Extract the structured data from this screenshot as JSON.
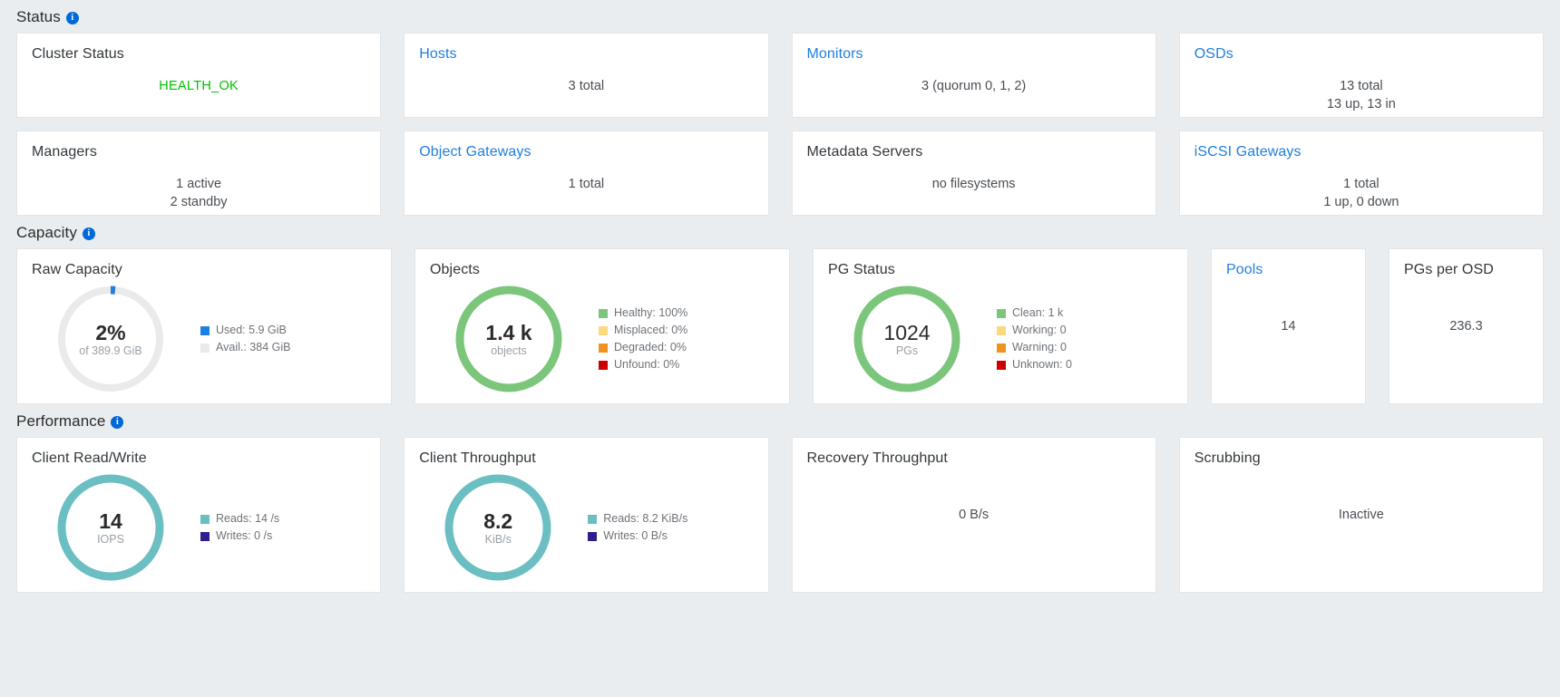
{
  "sections": {
    "status": {
      "title": "Status",
      "info_icon": "info-icon"
    },
    "capacity": {
      "title": "Capacity",
      "info_icon": "info-icon"
    },
    "performance": {
      "title": "Performance",
      "info_icon": "info-icon"
    }
  },
  "status_cards": [
    {
      "title": "Cluster Status",
      "link": false,
      "lines": [
        "HEALTH_OK"
      ],
      "health": true
    },
    {
      "title": "Hosts",
      "link": true,
      "lines": [
        "3 total"
      ],
      "health": false
    },
    {
      "title": "Monitors",
      "link": true,
      "lines": [
        "3 (quorum 0, 1, 2)"
      ],
      "health": false
    },
    {
      "title": "OSDs",
      "link": true,
      "lines": [
        "13 total",
        "13 up, 13 in"
      ],
      "health": false
    },
    {
      "title": "Managers",
      "link": false,
      "lines": [
        "1 active",
        "2 standby"
      ],
      "health": false
    },
    {
      "title": "Object Gateways",
      "link": true,
      "lines": [
        "1 total"
      ],
      "health": false
    },
    {
      "title": "Metadata Servers",
      "link": false,
      "lines": [
        "no filesystems"
      ],
      "health": false
    },
    {
      "title": "iSCSI Gateways",
      "link": true,
      "lines": [
        "1 total",
        "1 up, 0 down"
      ],
      "health": false
    }
  ],
  "capacity_cards": {
    "raw_capacity": {
      "title": "Raw Capacity",
      "center_value": "2%",
      "center_sub": "of 389.9 GiB",
      "legend": [
        {
          "label": "Used: 5.9 GiB",
          "color": "#1f7fe0"
        },
        {
          "label": "Avail.: 384 GiB",
          "color": "#eaeaea"
        }
      ]
    },
    "objects": {
      "title": "Objects",
      "center_value": "1.4 k",
      "center_sub": "objects",
      "legend": [
        {
          "label": "Healthy: 100%",
          "color": "#7bc67b"
        },
        {
          "label": "Misplaced: 0%",
          "color": "#fad97f"
        },
        {
          "label": "Degraded: 0%",
          "color": "#f0921e"
        },
        {
          "label": "Unfound: 0%",
          "color": "#cc0000"
        }
      ]
    },
    "pg_status": {
      "title": "PG Status",
      "center_value": "1024",
      "center_sub": "PGs",
      "legend": [
        {
          "label": "Clean: 1 k",
          "color": "#7bc67b"
        },
        {
          "label": "Working: 0",
          "color": "#fad97f"
        },
        {
          "label": "Warning: 0",
          "color": "#f0921e"
        },
        {
          "label": "Unknown: 0",
          "color": "#cc0000"
        }
      ]
    },
    "pools": {
      "title": "Pools",
      "link": true,
      "value": "14"
    },
    "pgs_per_osd": {
      "title": "PGs per OSD",
      "link": false,
      "value": "236.3"
    }
  },
  "performance_cards": {
    "client_read_write": {
      "title": "Client Read/Write",
      "center_value": "14",
      "center_sub": "IOPS",
      "legend": [
        {
          "label": "Reads: 14 /s",
          "color": "#6bbec2"
        },
        {
          "label": "Writes: 0 /s",
          "color": "#2d1f8f"
        }
      ]
    },
    "client_throughput": {
      "title": "Client Throughput",
      "center_value": "8.2",
      "center_sub": "KiB/s",
      "legend": [
        {
          "label": "Reads: 8.2 KiB/s",
          "color": "#6bbec2"
        },
        {
          "label": "Writes: 0 B/s",
          "color": "#2d1f8f"
        }
      ]
    },
    "recovery_throughput": {
      "title": "Recovery Throughput",
      "value": "0 B/s"
    },
    "scrubbing": {
      "title": "Scrubbing",
      "value": "Inactive"
    }
  },
  "chart_data": [
    {
      "type": "pie",
      "title": "Raw Capacity",
      "labels": [
        "Used: 5.9 GiB",
        "Avail.: 384 GiB"
      ],
      "values": [
        5.9,
        384
      ],
      "percent": [
        1.5,
        98.5
      ],
      "colors": [
        "#1f7fe0",
        "#eaeaea"
      ],
      "center_label": "2%",
      "center_sublabel": "of 389.9 GiB",
      "legend_position": "right",
      "donut": true
    },
    {
      "type": "pie",
      "title": "Objects",
      "labels": [
        "Healthy: 100%",
        "Misplaced: 0%",
        "Degraded: 0%",
        "Unfound: 0%"
      ],
      "values": [
        100,
        0,
        0,
        0
      ],
      "colors": [
        "#7bc67b",
        "#fad97f",
        "#f0921e",
        "#cc0000"
      ],
      "center_label": "1.4 k",
      "center_sublabel": "objects",
      "legend_position": "right",
      "donut": true
    },
    {
      "type": "pie",
      "title": "PG Status",
      "labels": [
        "Clean: 1 k",
        "Working: 0",
        "Warning: 0",
        "Unknown: 0"
      ],
      "values": [
        1024,
        0,
        0,
        0
      ],
      "colors": [
        "#7bc67b",
        "#fad97f",
        "#f0921e",
        "#cc0000"
      ],
      "center_label": "1024",
      "center_sublabel": "PGs",
      "legend_position": "right",
      "donut": true
    },
    {
      "type": "pie",
      "title": "Client Read/Write",
      "labels": [
        "Reads: 14 /s",
        "Writes: 0 /s"
      ],
      "values": [
        14,
        0
      ],
      "colors": [
        "#6bbec2",
        "#2d1f8f"
      ],
      "center_label": "14",
      "center_sublabel": "IOPS",
      "legend_position": "right",
      "donut": true
    },
    {
      "type": "pie",
      "title": "Client Throughput",
      "labels": [
        "Reads: 8.2 KiB/s",
        "Writes: 0 B/s"
      ],
      "values": [
        8.2,
        0
      ],
      "colors": [
        "#6bbec2",
        "#2d1f8f"
      ],
      "center_label": "8.2",
      "center_sublabel": "KiB/s",
      "legend_position": "right",
      "donut": true
    }
  ]
}
